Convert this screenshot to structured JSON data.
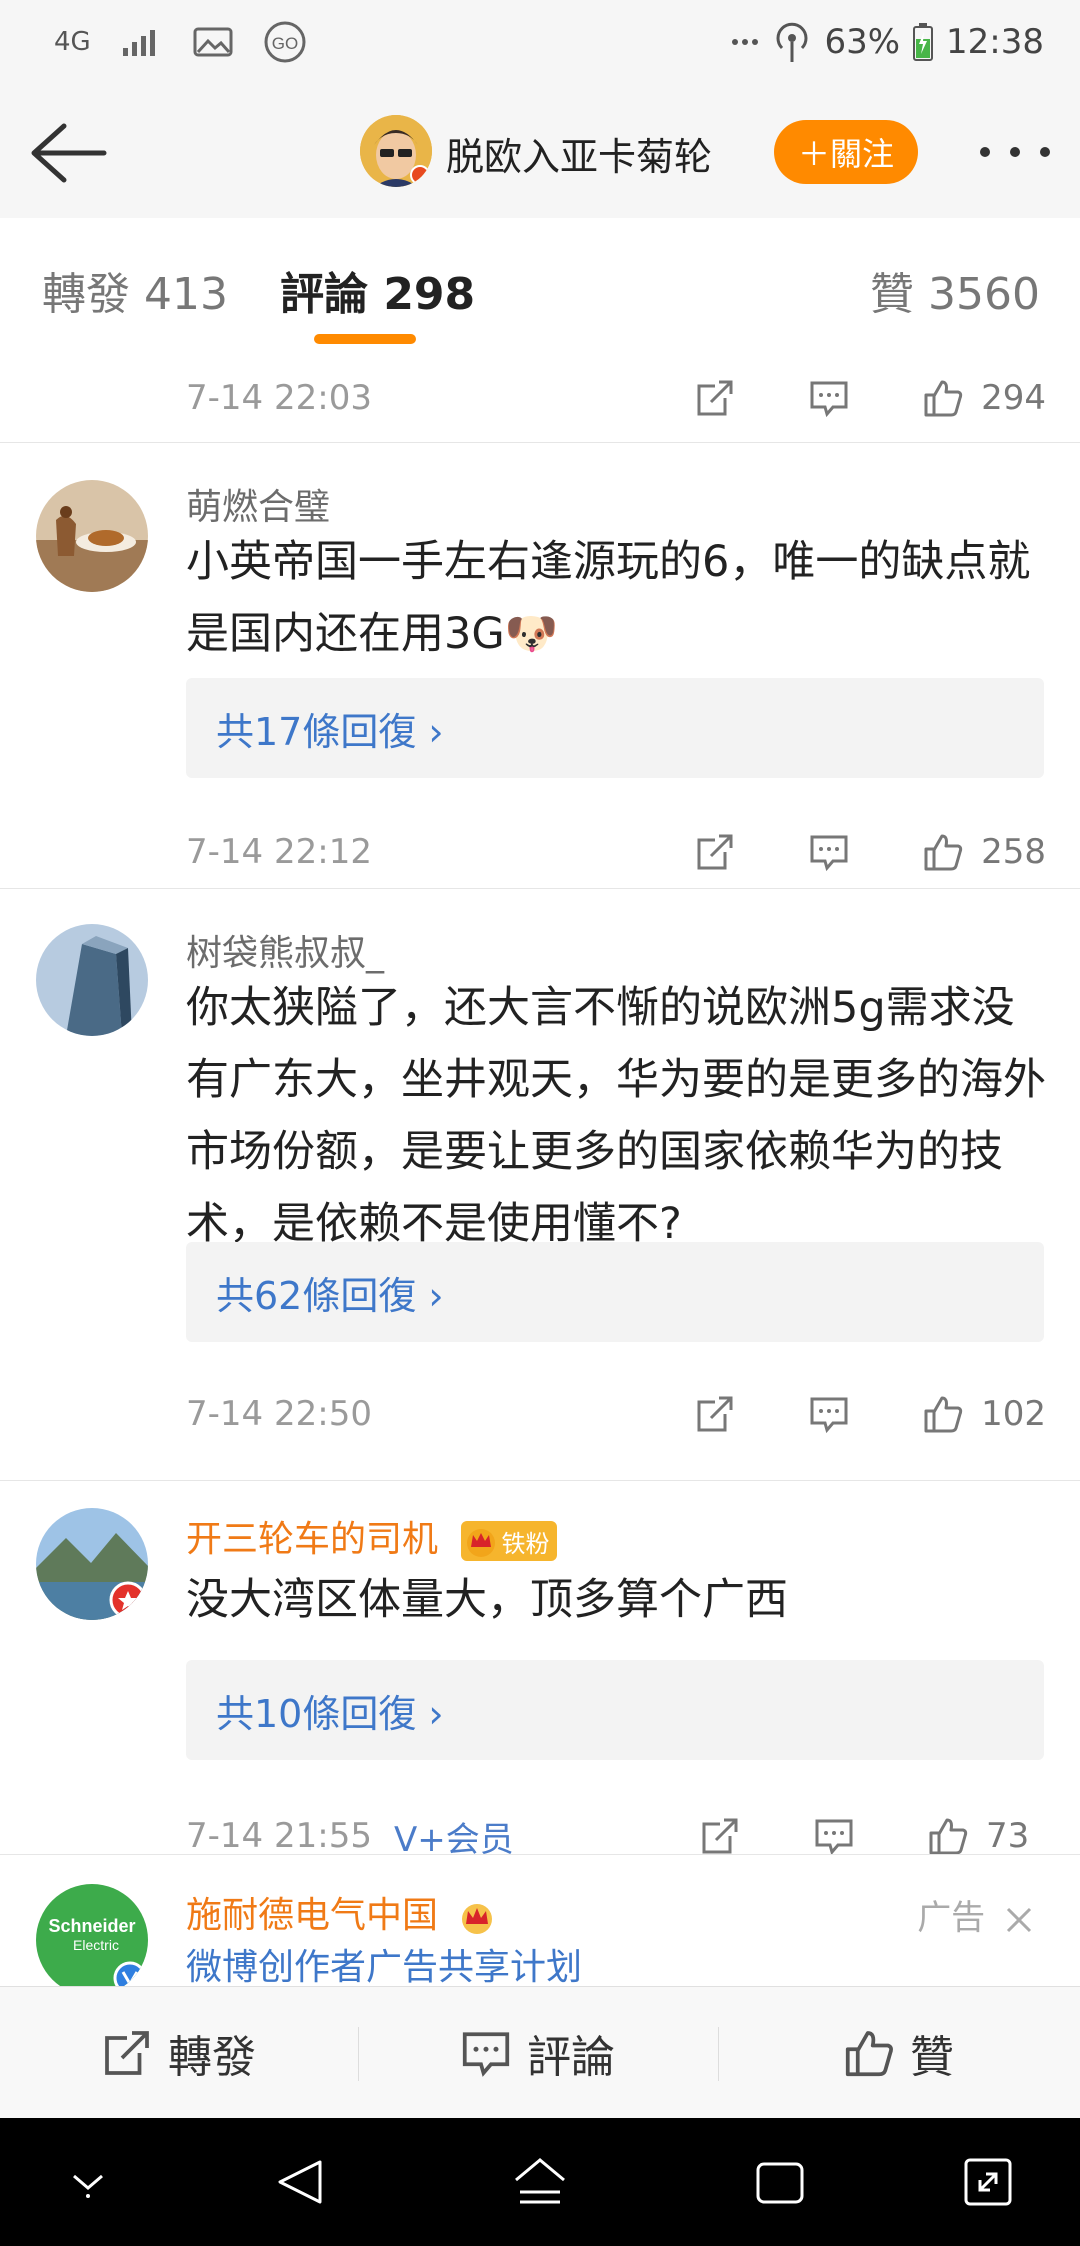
{
  "status_bar": {
    "network": "4G",
    "battery": "63%",
    "time": "12:38",
    "icons": [
      "signal-icon",
      "image-icon",
      "go-icon",
      "more-dots-icon",
      "hotspot-icon",
      "battery-icon"
    ]
  },
  "header": {
    "title": "脱欧入亚卡菊轮",
    "follow_label": "＋關注"
  },
  "tabs": {
    "repost": "轉發 413",
    "comments": "評論 298",
    "likes": "贊 3560"
  },
  "comments": [
    {
      "time": "7-14 22:03",
      "likes": "294"
    },
    {
      "name": "萌燃合璧",
      "text": "小英帝国一手左右逢源玩的6，唯一的缺点就是国内还在用3G",
      "emoji": "🐶",
      "replies": "共17條回復 ›",
      "time": "7-14 22:12",
      "likes": "258"
    },
    {
      "name": "树袋熊叔叔_",
      "text": "你太狭隘了，还大言不惭的说欧洲5g需求没有广东大，坐井观天，华为要的是更多的海外市场份额，是要让更多的国家依赖华为的技术，是依赖不是使用懂不?",
      "replies": "共62條回復 ›",
      "time": "7-14 22:50",
      "likes": "102"
    },
    {
      "name": "开三轮车的司机",
      "badge": "铁粉",
      "text": "没大湾区体量大，顶多算个广西",
      "replies": "共10條回復 ›",
      "time": "7-14 21:55",
      "vip": "V+会员",
      "likes": "73"
    },
    {
      "name": "施耐德电气中国",
      "text": "微博创作者广告共享计划",
      "ad_label": "广告",
      "avatar_text": "Schneider Electric 施耐德电气"
    }
  ],
  "bottom_bar": {
    "repost": "轉發",
    "comment": "評論",
    "like": "贊"
  },
  "colors": {
    "accent": "#ff8a00",
    "link": "#3e77c9",
    "gold_name": "#f07a16"
  }
}
